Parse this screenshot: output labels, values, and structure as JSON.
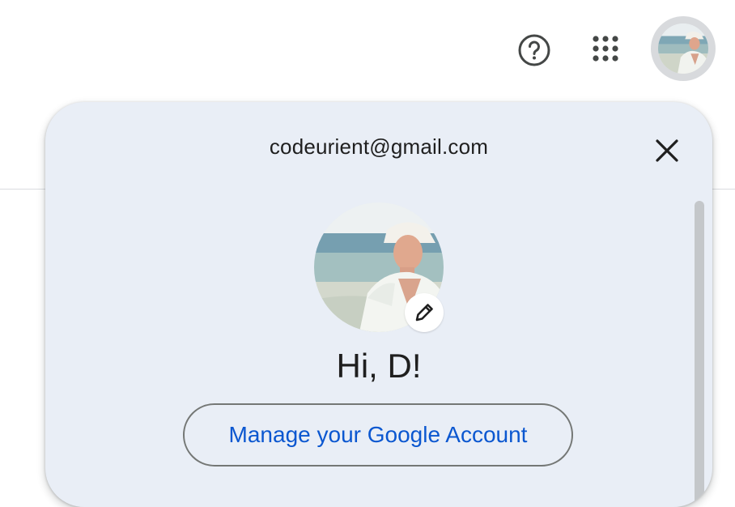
{
  "topbar": {
    "help_icon": "help-circle-icon",
    "apps_icon": "apps-grid-icon",
    "avatar_icon": "profile-photo"
  },
  "account_panel": {
    "email": "codeurient@gmail.com",
    "close_icon": "close-icon",
    "avatar_icon": "profile-photo",
    "edit_icon": "pencil-icon",
    "greeting": "Hi, D!",
    "manage_button_label": "Manage your Google Account"
  },
  "colors": {
    "panel_bg": "#e9eef6",
    "link_blue": "#0b57d0",
    "text": "#1f1f1f"
  }
}
